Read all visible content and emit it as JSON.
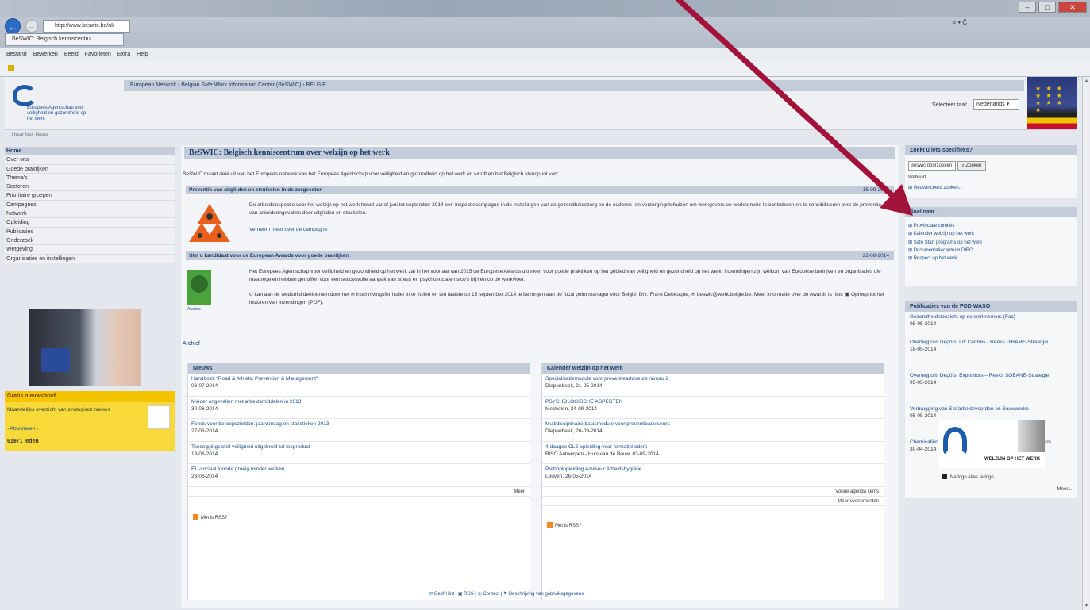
{
  "browser": {
    "address": "http://www.beswic.be/nl/",
    "search_hint": "⌕ ▾ Ĉ",
    "tab_label": "BeSWIC: Belgisch kenniscentru...",
    "menu": [
      "Bestand",
      "Bewerken",
      "Beeld",
      "Favorieten",
      "Extra",
      "Help"
    ],
    "window_buttons": {
      "min": "–",
      "max": "□",
      "close": "✕"
    }
  },
  "header": {
    "bar_text": "European Network › Belgian Safe Work Information Center (BeSWIC) › BELGIË",
    "logo_text": "Europees Agentschap voor veiligheid en gezondheid op het werk",
    "lang_label": "Selecteer taal:",
    "lang_value": "Nederlands ▾",
    "eu_stars": "★ ★ ★ ★ ★ ★ ★ ★ ★ ★"
  },
  "breadcrumb": "U bent hier: Home",
  "leftnav": [
    "Home",
    "Over ons",
    "Goede praktijken",
    "Thema's",
    "Sectoren",
    "Prioritaire groepen",
    "Campagnes",
    "Netwerk",
    "Opleiding",
    "Publicaties",
    "Onderzoek",
    "Wetgeving",
    "Organisaties en instellingen"
  ],
  "newsletter": {
    "title": "Gratis nieuwsbrief",
    "text": "Maandelijks overzicht van strategisch nieuws",
    "subscribe": "› Abonneren ‹",
    "count": "61971 leden"
  },
  "main": {
    "title": "BeSWIC: Belgisch kenniscentrum over welzijn op het werk",
    "intro": "BeSWIC maakt deel uit van het Europees netwerk van het Europees Agentschap voor veiligheid en gezondheid op het werk en wordt en het Belgisch steunpunt van:",
    "sections": [
      {
        "title": "Preventie van uitglijden en struikelen in de zorgsector",
        "date": "15-09-2014",
        "text": "De arbeidsinspectie voor het welzijn op het werk houdt vanaf juni tot september 2014 een inspectiecampagne in de instellingen van de gezondheidszorg en de ouderen- en verzorgingstehuizen om werkgevers en werknemers te controleren en te sensibiliseren over de preventie van arbeidsongevallen door uitglijden en struikelen.",
        "link": "Verneem meer over de campagne"
      },
      {
        "title": "Stel u kandidaat voor de European Awards voor goede praktijken",
        "date": "22-08-2014",
        "text": "Het Europees Agentschap voor veiligheid en gezondheid op het werk zal in het voorjaar van 2015 de Europese Awards uitreiken voor goede praktijken op het gebied van veiligheid en gezondheid op het werk. Inzendingen zijn welkom van Europese bedrijven en organisaties die maatregelen hebben getroffen voor een succesvolle aanpak van stress en psychosociale risico's bij hen op de werkvloer.",
        "text2": "U kan aan de wedstrijd deelnemen door het ✉ inschrijvingsformulier in te vullen en ten laatste op 15 september 2014 te bezorgen aan de focal point manager voor België: Dhr. Frank Debeuque, ✉ beswic@werk.belgie.be. Meer informatie over de Awards is hier: ▣ Oproep tot het insturen van inzendingen (PDF).",
        "award_label": "Awards"
      }
    ],
    "archive": "Archief",
    "news": {
      "title": "Nieuws",
      "items": [
        {
          "t": "Handboek \"Road & Athletic Prevention & Management\"",
          "d": "03-07-2014"
        },
        {
          "t": "Minder ongevallen met arbeidsmiddelen in 2013",
          "d": "30-06-2014"
        },
        {
          "t": "Fonds voor beroepsziekten: jaarverslag en statistieken 2013",
          "d": "27-06-2014"
        },
        {
          "t": "Toezeggingsbrief veiligheid uitgebreid tot leeproduct",
          "d": "19-06-2014"
        },
        {
          "t": "EU-sociaal toonde groeig minder werken",
          "d": "23-06-2014"
        }
      ],
      "more": "Meer",
      "rss": "Met is RSS?"
    },
    "calendar": {
      "title": "Kalender welzijn op het werk",
      "items": [
        {
          "t": "Specialisatiemodule voor preventieadviseurs niveau 2",
          "d": "Diepenbeek, 21-05-2014"
        },
        {
          "t": "PSYCHOLOGISCHE ASPECTEN",
          "d": "Mechelen, 24-09-2014"
        },
        {
          "t": "Multidisciplinaire basismodule voor preventieadviseurs",
          "d": "Diepenbeek, 26-09-2014"
        },
        {
          "t": "4-daagse CLS opleiding voor formatieleiders",
          "d": "BISO Antwerpen - Huis van de Bouw, 03-09-2014"
        },
        {
          "t": "Preboplopleiding Adviseur Arbeidshygiëne",
          "d": "Leuven, 26-05-2014"
        }
      ],
      "more1": "Vorige agenda items",
      "more2": "Meer evenementen",
      "rss": "Met is RSS?"
    }
  },
  "right": {
    "search_title": "Zoekt u iets specifieks?",
    "search_placeholder": "Beswic doorzoeken",
    "search_button": "⌕ Zoeken",
    "search_web": "Websort",
    "search_advanced": "⊞ Geavanceerd zoeken...",
    "quick_title": "Snel naar ...",
    "quick_links": [
      "⊞ Provinciale comités",
      "⊞ Kalender welzijn op het werk",
      "⊞ Safe Start programs op het werk",
      "⊞ Documentatiecentrum DIBO",
      "⊞ Respect op het werk"
    ],
    "pub_title": "Publicaties van de FOD WASO",
    "pubs": [
      {
        "t": "Gezondheidstoezicht op de werknemers (Fac)",
        "d": "05-05-2014"
      },
      {
        "t": "Overlegpolis Depôts: Lift Centres - Reeks DIBAME-Strategie",
        "d": "18-05-2014"
      },
      {
        "t": "Overlegpolis Depôts: Expositors – Reeks SOBANE-Strategie",
        "d": "05-05-2014"
      },
      {
        "t": "Verbrugging van Stofarbeidsvoorden en Bouwwerke",
        "d": "05-05-2014"
      },
      {
        "t": "Chemicaliën op de werkvloer: een nieuw etiketteringssysteem",
        "d": "30-04-2014"
      }
    ],
    "pub_more": "Meer...",
    "wow_text": "WELZIJN OP HET WERK",
    "logo_link": "Na logo Alles te logo"
  },
  "footer": "✉ Geef Hint | ▣ RSS | ◎ Contact | ⚑ Beschrijving van gebruiksgegevens",
  "colors": {
    "arrow": "#a3123a",
    "nav_bar": "#c5ccd9",
    "newsletter": "#f5c400"
  }
}
